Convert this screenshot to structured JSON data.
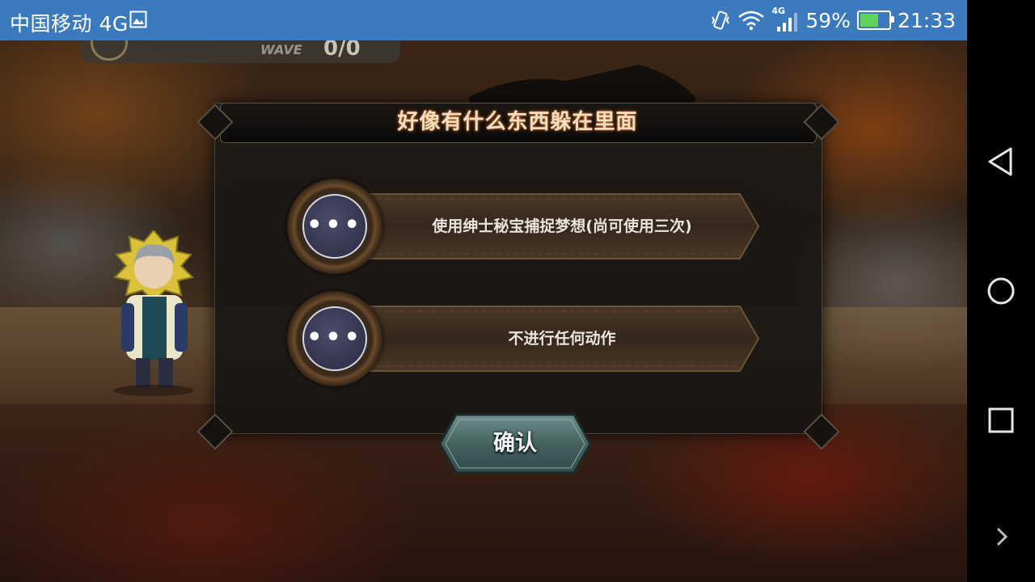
{
  "status_bar": {
    "carrier": "中国移动 4G",
    "network": "4G",
    "battery": "59%",
    "time": "21:33",
    "icons": [
      "image-icon",
      "vibrate-icon",
      "wifi-icon",
      "signal-icon",
      "battery-icon"
    ]
  },
  "hud": {
    "wave_label": "WAVE",
    "wave_count": "0/0"
  },
  "dialog": {
    "title": "好像有什么东西躲在里面",
    "options": [
      {
        "dots": "•••",
        "label": "使用绅士秘宝捕捉梦想(尚可使用三次)"
      },
      {
        "dots": "•••",
        "label": "不进行任何动作"
      }
    ],
    "confirm_label": "确认"
  },
  "colors": {
    "status_bar_bg": "#3b7bbd",
    "title_text": "#f3dfc0",
    "title_glow": "#c7692a",
    "option_bar": "#3a2c1e",
    "confirm_button": "#4a6a68"
  },
  "navbar": {
    "icons": [
      "back-icon",
      "home-icon",
      "recents-icon",
      "expand-icon"
    ]
  }
}
